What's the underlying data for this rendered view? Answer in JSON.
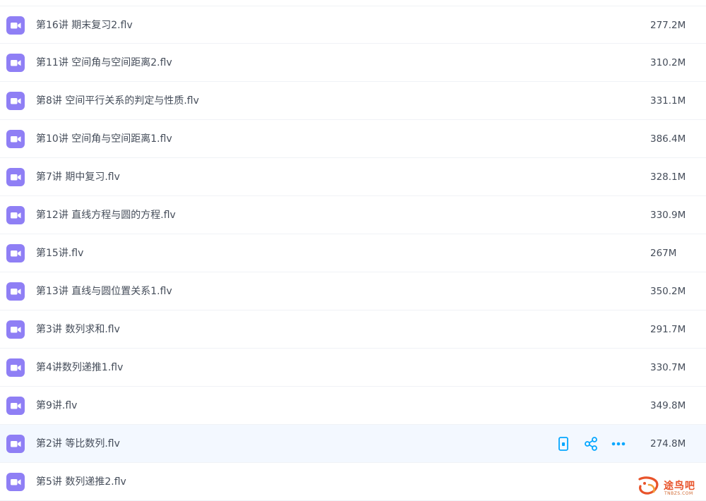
{
  "file_list": {
    "items": [
      {
        "name": "第16讲 期末复习2.flv",
        "size": "277.2M"
      },
      {
        "name": "第11讲 空间角与空间距离2.flv",
        "size": "310.2M"
      },
      {
        "name": "第8讲 空间平行关系的判定与性质.flv",
        "size": "331.1M"
      },
      {
        "name": "第10讲 空间角与空间距离1.flv",
        "size": "386.4M"
      },
      {
        "name": "第7讲 期中复习.flv",
        "size": "328.1M"
      },
      {
        "name": "第12讲 直线方程与圆的方程.flv",
        "size": "330.9M"
      },
      {
        "name": "第15讲.flv",
        "size": "267M"
      },
      {
        "name": "第13讲 直线与圆位置关系1.flv",
        "size": "350.2M"
      },
      {
        "name": "第3讲 数列求和.flv",
        "size": "291.7M"
      },
      {
        "name": "第4讲数列递推1.flv",
        "size": "330.7M"
      },
      {
        "name": "第9讲.flv",
        "size": "349.8M"
      },
      {
        "name": "第2讲 等比数列.flv",
        "size": "274.8M",
        "hovered": true
      },
      {
        "name": "第5讲 数列递推2.flv",
        "size": ""
      }
    ],
    "file_icon": "video-file-icon",
    "row_actions": [
      "phone-icon",
      "share-icon",
      "more-icon"
    ]
  },
  "watermark": {
    "text": "途鸟吧",
    "sub": "TNBZS.COM"
  },
  "colors": {
    "icon_purple": "#8f7ff5",
    "action_blue": "#06a7ff",
    "hover_bg": "#f3f8ff",
    "watermark": "#e8532a"
  }
}
